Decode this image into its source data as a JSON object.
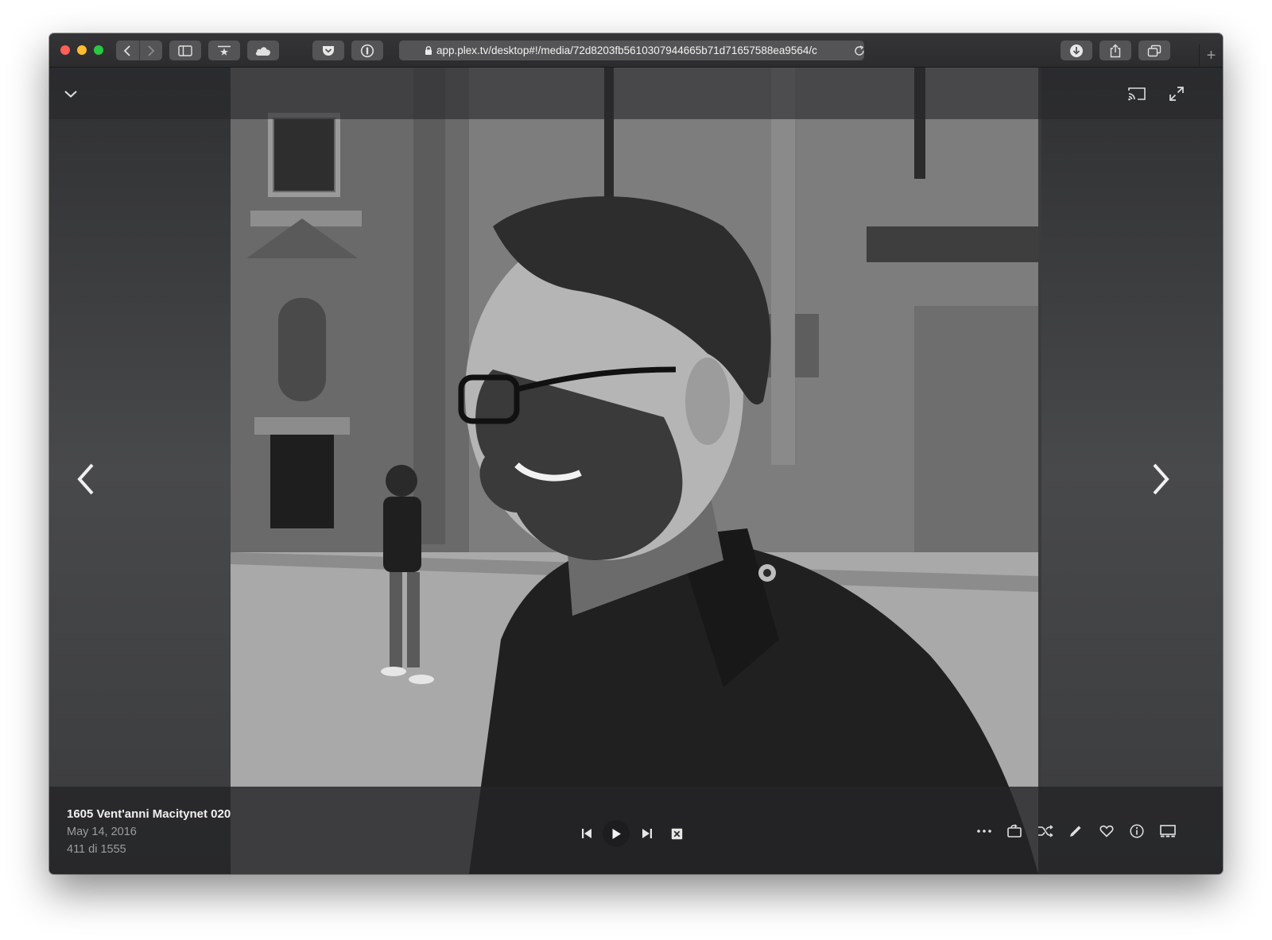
{
  "browser": {
    "url": "app.plex.tv/desktop#!/media/72d8203fb5610307944665b71d71657588ea9564/c",
    "new_tab": "+"
  },
  "photo": {
    "title": "1605 Vent'anni Macitynet 020",
    "date": "May 14, 2016",
    "position": "411 di 1555"
  },
  "icons": {
    "collapse": "chevron-down-icon",
    "cast": "cast-icon",
    "fullscreen": "expand-icon",
    "prev": "chevron-left-icon",
    "next": "chevron-right-icon",
    "controls": [
      "skip-previous-icon",
      "play-icon",
      "skip-next-icon",
      "close-box-icon"
    ],
    "actions": [
      "more-icon",
      "rotate-icon",
      "shuffle-icon",
      "edit-icon",
      "heart-icon",
      "info-icon",
      "slideshow-icon"
    ]
  }
}
